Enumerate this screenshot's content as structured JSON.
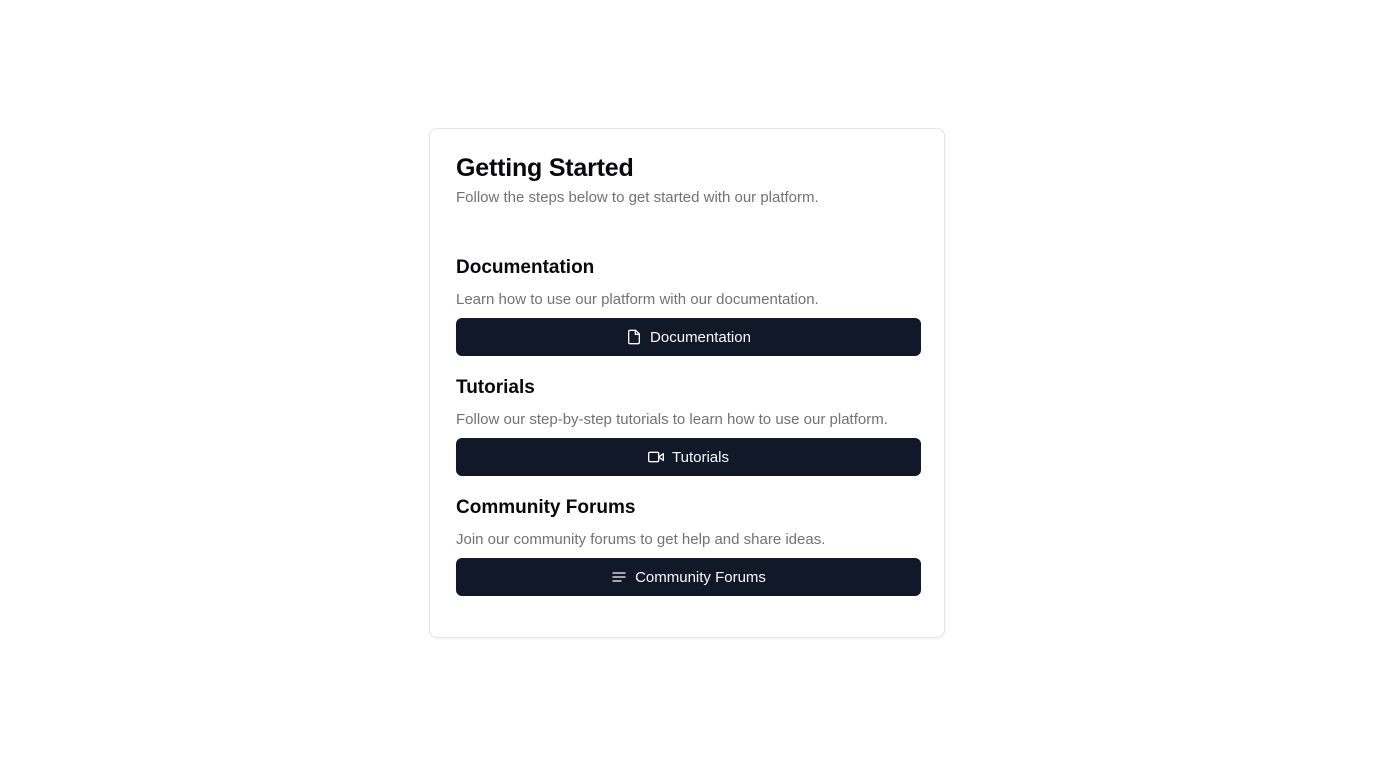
{
  "card": {
    "title": "Getting Started",
    "subtitle": "Follow the steps below to get started with our platform."
  },
  "sections": [
    {
      "title": "Documentation",
      "description": "Learn how to use our platform with our documentation.",
      "button_label": "Documentation",
      "icon": "file-icon"
    },
    {
      "title": "Tutorials",
      "description": "Follow our step-by-step tutorials to learn how to use our platform.",
      "button_label": "Tutorials",
      "icon": "video-icon"
    },
    {
      "title": "Community Forums",
      "description": "Join our community forums to get help and share ideas.",
      "button_label": "Community Forums",
      "icon": "text-lines-icon"
    }
  ],
  "colors": {
    "button_background": "#111827",
    "button_text": "#f8fafc",
    "muted_text": "#71717a",
    "heading_text": "#09090b",
    "card_border": "#e4e4e7"
  }
}
